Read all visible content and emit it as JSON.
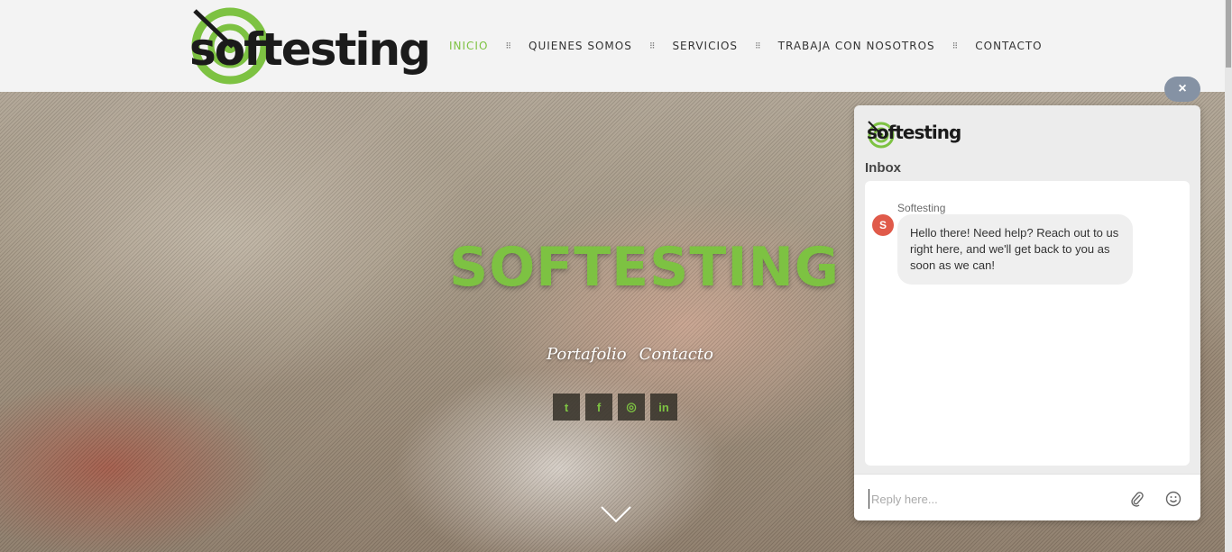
{
  "brand": {
    "name": "softesting",
    "accent_color": "#7dc242",
    "dark_color": "#1b1b1b"
  },
  "nav": {
    "items": [
      {
        "label": "INICIO",
        "active": true
      },
      {
        "label": "QUIENES SOMOS",
        "active": false
      },
      {
        "label": "SERVICIOS",
        "active": false
      },
      {
        "label": "TRABAJA CON NOSOTROS",
        "active": false
      },
      {
        "label": "CONTACTO",
        "active": false
      }
    ],
    "separator": "⠿"
  },
  "hero": {
    "title": "SOFTESTING",
    "links": [
      "Portafolio",
      "Contacto"
    ],
    "social": [
      {
        "icon": "twitter-icon",
        "glyph": "t"
      },
      {
        "icon": "facebook-icon",
        "glyph": "f"
      },
      {
        "icon": "instagram-icon",
        "glyph": "◎"
      },
      {
        "icon": "linkedin-icon",
        "glyph": "in"
      }
    ]
  },
  "chat": {
    "close_label": "×",
    "logo_text": "softesting",
    "inbox_label": "Inbox",
    "message": {
      "sender": "Softesting",
      "avatar_initial": "S",
      "text": "Hello there! Need help? Reach out to us right here, and we'll get back to you as soon as we can!"
    },
    "reply_placeholder": "Reply here..."
  }
}
